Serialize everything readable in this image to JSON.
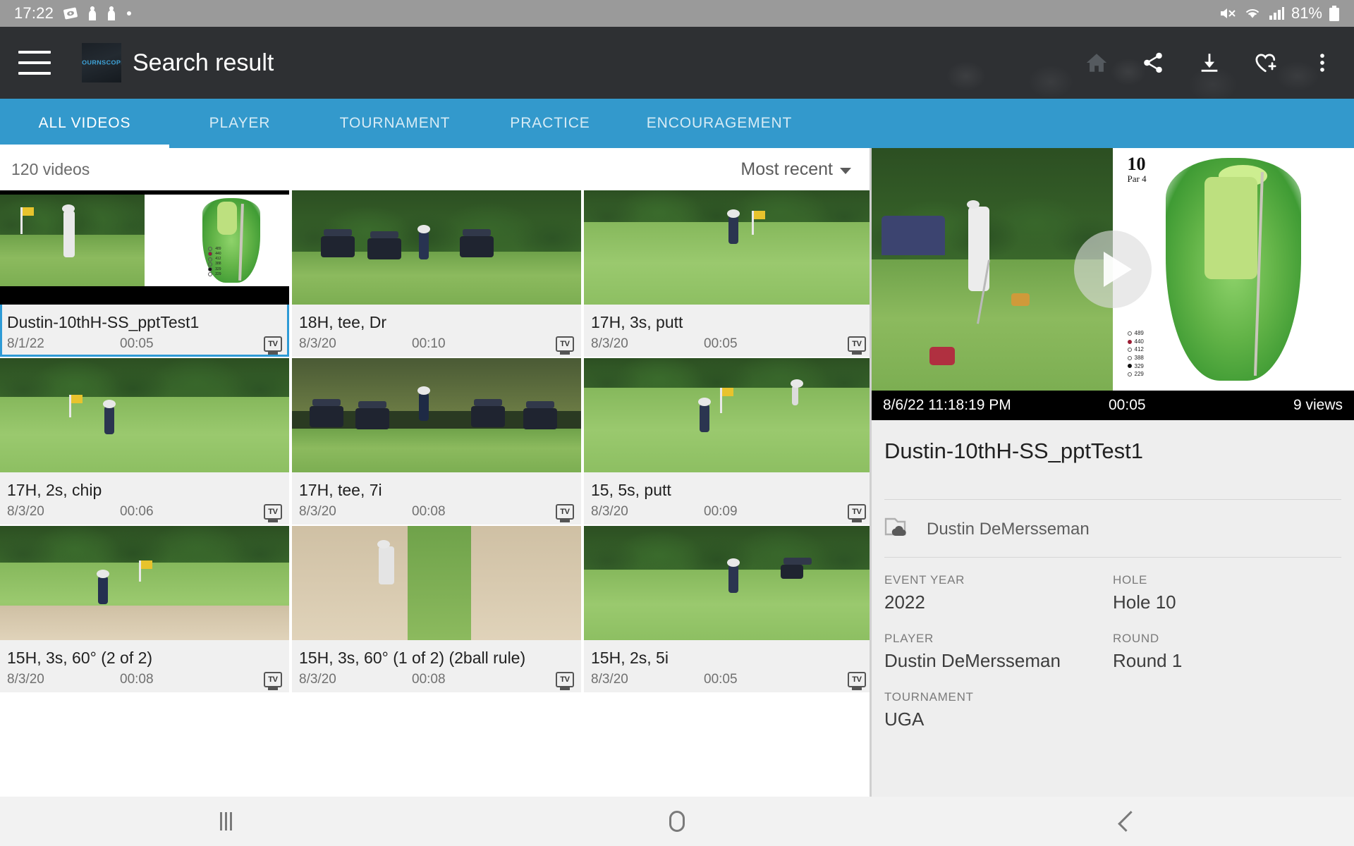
{
  "status_bar": {
    "time": "17:22",
    "battery_percent": "81%",
    "icons": [
      "screenshot-icon",
      "person-icon",
      "person-icon",
      "dot-icon",
      "mute-icon",
      "wifi-icon",
      "signal-icon",
      "battery-icon"
    ]
  },
  "toolbar": {
    "title": "Search result",
    "logo_text": "TOURNSCOPE",
    "menu_icon": "hamburger-menu-icon",
    "actions": [
      {
        "name": "home-icon",
        "label": "Home"
      },
      {
        "name": "share-icon",
        "label": "Share"
      },
      {
        "name": "download-icon",
        "label": "Download"
      },
      {
        "name": "favorite-add-icon",
        "label": "Add to favorites"
      },
      {
        "name": "overflow-menu-icon",
        "label": "More options"
      }
    ]
  },
  "tabs": {
    "active_index": 0,
    "items": [
      {
        "label": "ALL VIDEOS"
      },
      {
        "label": "PLAYER"
      },
      {
        "label": "TOURNAMENT"
      },
      {
        "label": "PRACTICE"
      },
      {
        "label": "ENCOURAGEMENT"
      }
    ]
  },
  "list_header": {
    "count_label": "120 videos",
    "sort_label": "Most recent"
  },
  "grid": {
    "badge_label": "TV",
    "cards": [
      {
        "title": "Dustin-10thH-SS_pptTest1",
        "date": "8/1/22",
        "duration": "00:05",
        "badge": "TV",
        "selected": true,
        "scene": "tee-with-map"
      },
      {
        "title": "18H, tee, Dr",
        "date": "8/3/20",
        "duration": "00:10",
        "badge": "TV",
        "selected": false,
        "scene": "tee-carts"
      },
      {
        "title": "17H, 3s, putt",
        "date": "8/3/20",
        "duration": "00:05",
        "badge": "TV",
        "selected": false,
        "scene": "green-putt"
      },
      {
        "title": "17H, 2s, chip",
        "date": "8/3/20",
        "duration": "00:06",
        "badge": "TV",
        "selected": false,
        "scene": "fairway-chip"
      },
      {
        "title": "17H, tee, 7i",
        "date": "8/3/20",
        "duration": "00:08",
        "badge": "TV",
        "selected": false,
        "scene": "carts-row"
      },
      {
        "title": "15, 5s, putt",
        "date": "8/3/20",
        "duration": "00:09",
        "badge": "TV",
        "selected": false,
        "scene": "green-flag"
      },
      {
        "title": "15H, 3s, 60° (2 of 2)",
        "date": "8/3/20",
        "duration": "00:08",
        "badge": "TV",
        "selected": false,
        "scene": "bunker"
      },
      {
        "title": "15H, 3s, 60° (1 of 2) (2ball rule)",
        "date": "8/3/20",
        "duration": "00:08",
        "badge": "TV",
        "selected": false,
        "scene": "bunker-close"
      },
      {
        "title": "15H, 2s, 5i",
        "date": "8/3/20",
        "duration": "00:05",
        "badge": "TV",
        "selected": false,
        "scene": "fairway-swing"
      }
    ]
  },
  "player": {
    "play_icon": "play-button-icon",
    "date_time": "8/6/22 11:18:19 PM",
    "duration": "00:05",
    "views": "9 views",
    "hole_map": {
      "hole_number": "10",
      "par": "Par 4",
      "tee_distances": [
        "489",
        "440",
        "412",
        "388",
        "329",
        "229"
      ]
    }
  },
  "detail": {
    "title": "Dustin-10thH-SS_pptTest1",
    "owner_icon": "folder-cloud-icon",
    "owner": "Dustin DeMersseman",
    "fields": [
      {
        "label": "EVENT YEAR",
        "value": "2022"
      },
      {
        "label": "HOLE",
        "value": "Hole 10"
      },
      {
        "label": "PLAYER",
        "value": "Dustin DeMersseman"
      },
      {
        "label": "ROUND",
        "value": "Round 1"
      },
      {
        "label": "TOURNAMENT",
        "value": "UGA"
      }
    ]
  },
  "nav_bar": {
    "items": [
      {
        "name": "recents-icon",
        "label": "Recents"
      },
      {
        "name": "home-icon",
        "label": "Home"
      },
      {
        "name": "back-icon",
        "label": "Back"
      }
    ]
  },
  "colors": {
    "accent": "#3399cc",
    "toolbar": "#2e3033",
    "status_bar": "#9a9a9a",
    "selection": "#2e9bd6",
    "panel_bg": "#eeeeee"
  }
}
